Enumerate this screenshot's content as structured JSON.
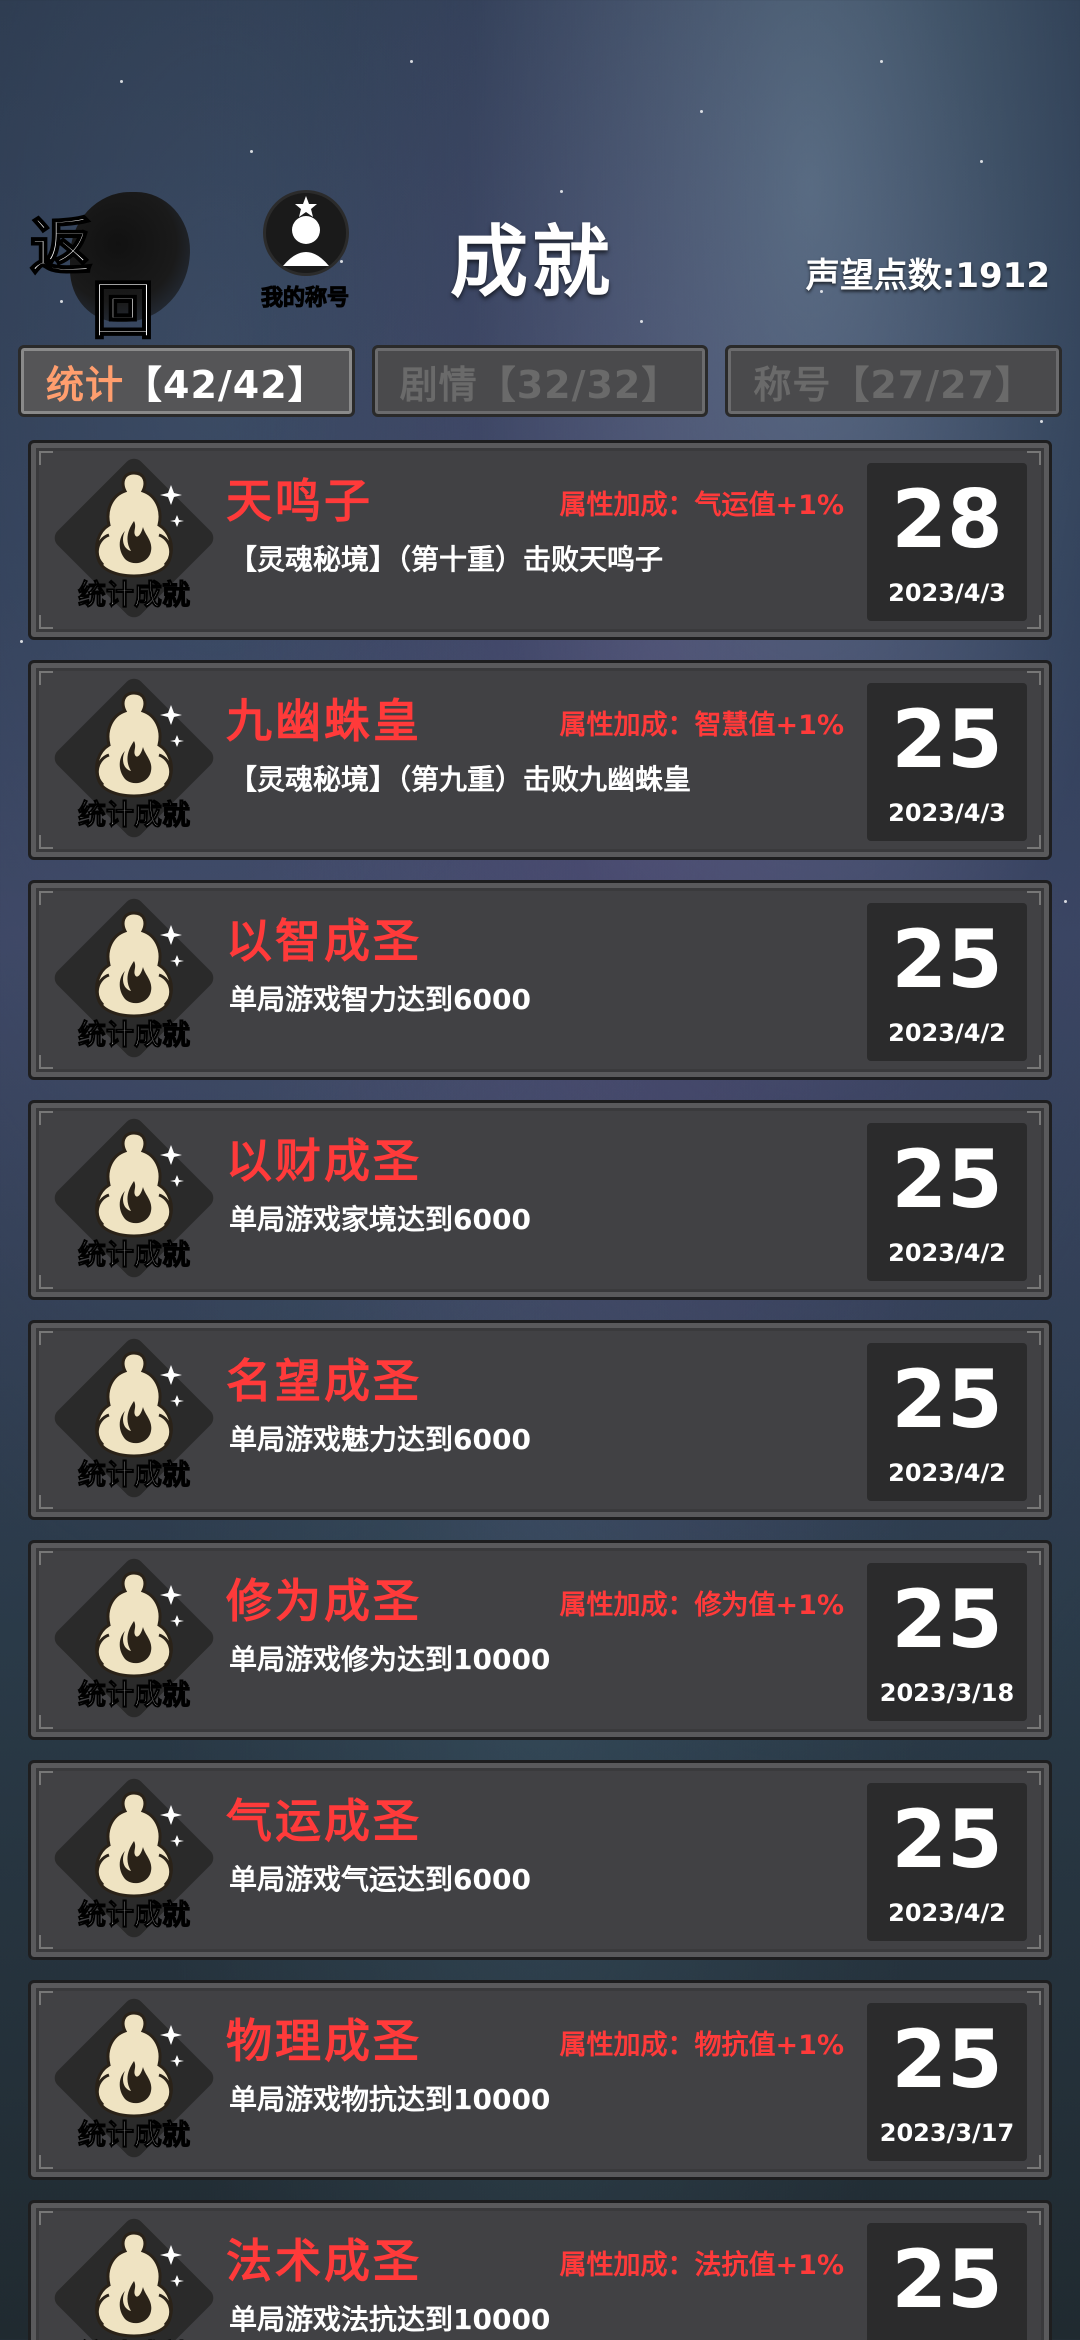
{
  "header": {
    "back_char_1": "返",
    "back_char_2": "回",
    "title_button_label": "我的称号",
    "page_title": "成就",
    "reputation": "声望点数:1912"
  },
  "tabs": [
    {
      "name": "统计",
      "count": "【42/42】",
      "active": true
    },
    {
      "name": "剧情",
      "count": "【32/32】",
      "active": false
    },
    {
      "name": "称号",
      "count": "【27/27】",
      "active": false
    }
  ],
  "badge_label": "统计成就",
  "achievements": [
    {
      "name": "天鸣子",
      "bonus": "属性加成：气运值+1%",
      "desc": "【灵魂秘境】（第十重）击败天鸣子",
      "points": "28",
      "date": "2023/4/3"
    },
    {
      "name": "九幽蛛皇",
      "bonus": "属性加成：智慧值+1%",
      "desc": "【灵魂秘境】（第九重）击败九幽蛛皇",
      "points": "25",
      "date": "2023/4/3"
    },
    {
      "name": "以智成圣",
      "bonus": "",
      "desc": "单局游戏智力达到6000",
      "points": "25",
      "date": "2023/4/2"
    },
    {
      "name": "以财成圣",
      "bonus": "",
      "desc": "单局游戏家境达到6000",
      "points": "25",
      "date": "2023/4/2"
    },
    {
      "name": "名望成圣",
      "bonus": "",
      "desc": "单局游戏魅力达到6000",
      "points": "25",
      "date": "2023/4/2"
    },
    {
      "name": "修为成圣",
      "bonus": "属性加成：修为值+1%",
      "desc": "单局游戏修为达到10000",
      "points": "25",
      "date": "2023/3/18"
    },
    {
      "name": "气运成圣",
      "bonus": "",
      "desc": "单局游戏气运达到6000",
      "points": "25",
      "date": "2023/4/2"
    },
    {
      "name": "物理成圣",
      "bonus": "属性加成：物抗值+1%",
      "desc": "单局游戏物抗达到10000",
      "points": "25",
      "date": "2023/3/17"
    },
    {
      "name": "法术成圣",
      "bonus": "属性加成：法抗值+1%",
      "desc": "单局游戏法抗达到10000",
      "points": "25",
      "date": ""
    }
  ],
  "colors": {
    "accent_red": "#ff3a3a",
    "active_tab_text": "#ff9e6e"
  }
}
